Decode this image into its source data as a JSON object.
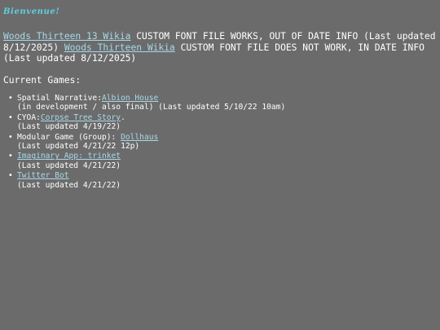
{
  "header": {
    "title": "Bienvenue!"
  },
  "intro": {
    "link1": "Woods Thirteen 13 Wikia",
    "text1": " CUSTOM FONT FILE WORKS, OUT OF DATE INFO (Last updated 8/12/2025) ",
    "link2": "Woods Thirteen Wikia",
    "text2": " CUSTOM FONT FILE DOES NOT WORK, IN DATE INFO (Last updated 8/12/2025)"
  },
  "games": {
    "heading": "Current Games:",
    "items": [
      {
        "prefix": "Spatial Narrative:",
        "link": "Albion House",
        "suffix": "",
        "detail": "(in development / also final) (Last updated 5/10/22 10am)"
      },
      {
        "prefix": "CYOA:",
        "link": "Corpse Tree Story",
        "suffix": ".",
        "detail": "(Last updated 4/19/22)"
      },
      {
        "prefix": "Modular Game (Group): ",
        "link": "Dollhaus",
        "suffix": "",
        "detail": "(Last updated 4/21/22 12p)"
      },
      {
        "prefix": "",
        "link": "Imaginary App: trinket",
        "suffix": "",
        "detail": "(Last updated 4/21/22)"
      },
      {
        "prefix": "",
        "link": "Twitter Bot",
        "suffix": "",
        "detail": "(Last updated 4/21/22)"
      }
    ]
  },
  "colors": {
    "background": "#6b6b6b",
    "title": "#5fd0e0",
    "link": "#a8d8e8",
    "text": "#ffffff"
  }
}
